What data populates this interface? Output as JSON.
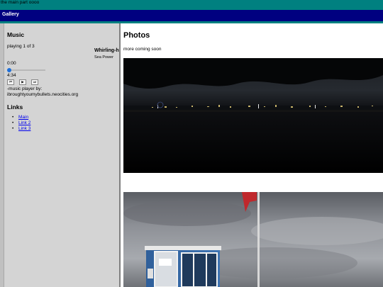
{
  "header": {
    "text": "the main part oooo"
  },
  "window": {
    "title": "Gallery"
  },
  "music": {
    "heading": "Music",
    "status": "playing 1 of 3",
    "song_title": "Whirling-h",
    "song_artist": "Sea Power",
    "current_time": "0:00",
    "duration": "4:34",
    "progress_fraction": 0,
    "controls": [
      "previous-icon",
      "play-icon",
      "next-icon"
    ],
    "credit_line1": "-music player by:",
    "credit_line2": "ibroughtyoumybullets.neocities.org"
  },
  "links": {
    "heading": "Links",
    "items": [
      "Main",
      "Link 2",
      "Link 3"
    ]
  },
  "main": {
    "heading": "Photos",
    "subtitle": "more coming soon"
  },
  "colors": {
    "topbar": "#008080",
    "titlebar": "#000080",
    "sidebar": "#d4d4d4",
    "link": "#0000ee",
    "seek_knob": "#1e6fd9"
  }
}
